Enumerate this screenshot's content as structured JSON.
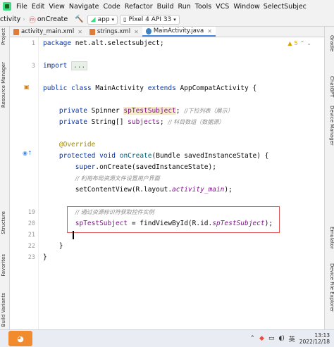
{
  "menubar": {
    "items": [
      "File",
      "Edit",
      "View",
      "Navigate",
      "Code",
      "Refactor",
      "Build",
      "Run",
      "Tools",
      "VCS",
      "Window"
    ],
    "window_title": "SelectSubjec"
  },
  "toolbar": {
    "left_text": "ctivity",
    "method": "onCreate",
    "run_config": "app",
    "device": "Pixel 4 API 33"
  },
  "tabs": [
    {
      "label": "activity_main.xml",
      "active": false
    },
    {
      "label": "strings.xml",
      "active": false
    },
    {
      "label": "MainActivity.java",
      "active": true
    }
  ],
  "left_strip": {
    "labels": [
      "Project",
      "Resource Manager",
      "Structure",
      "Favorites",
      "Build Variants"
    ]
  },
  "right_strip": {
    "labels": [
      "Gradle",
      "ChatGPT",
      "Device Manager",
      "Emulator",
      "Device File Explorer"
    ]
  },
  "inspection": {
    "warnings": "5"
  },
  "editor": {
    "line_numbers": [
      "1",
      "",
      "3",
      "",
      "",
      "",
      "",
      "",
      "",
      "",
      "",
      "",
      "",
      "",
      "",
      "",
      "",
      "",
      "19",
      "20",
      "21",
      "22",
      "23"
    ],
    "visible_numbers": {
      "n1": "1",
      "n3": "3",
      "n19": "19",
      "n20": "20",
      "n21": "21",
      "n22": "22",
      "n23": "23"
    },
    "code": {
      "package_kw": "package",
      "package_name": " net.alt.selectsubject;",
      "import_kw": "import",
      "import_fold": "...",
      "cls_public": "public",
      "cls_class": "class",
      "cls_name": " MainActivity ",
      "cls_extends": "extends",
      "cls_rest": " AppCompatActivity {",
      "l_private1": "private",
      "l_type1": " Spinner ",
      "l_field1": "spTestSubject",
      "l_semi1": "; ",
      "l_cm1": "//下拉列表（展示）",
      "l_private2": "private",
      "l_type2": " String[] ",
      "l_field2": "subjects",
      "l_semi2": "; ",
      "l_cm2": "// 科目数组（数据源）",
      "override": "@Override",
      "protected": "protected",
      "void": "void",
      "oncreate": "onCreate",
      "oncreate_params": "(Bundle savedInstanceState) {",
      "super_kw": "super",
      "super_rest": ".onCreate(savedInstanceState);",
      "cm_layout": "// 利用布局资源文件设置用户界面",
      "setcv": "setContentView(R.layout.",
      "setcv_field": "activity_main",
      "setcv_end": ");",
      "cm_find": "// 通过资源标识符获取控件实例",
      "find_field": "spTestSubject",
      "find_mid": " = findViewById(R.id.",
      "find_id": "spTestSubject",
      "find_end": ");",
      "close_method": "}",
      "close_class": "}"
    }
  },
  "taskbar": {
    "ime": "英",
    "time": "13:13",
    "date": "2022/12/18"
  },
  "colors": {
    "keyword": "#0033b3",
    "annotation": "#9e880d",
    "field": "#871094",
    "comment": "#8c8c8c",
    "selection_border": "#e05555",
    "active_tab_underline": "#4a88e0"
  }
}
